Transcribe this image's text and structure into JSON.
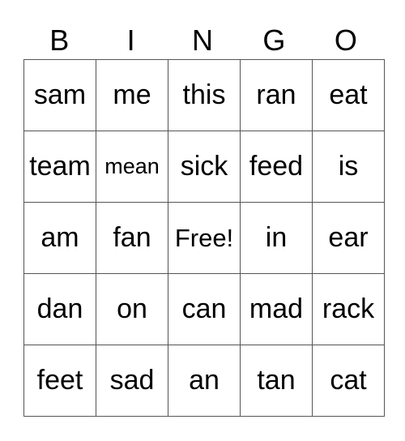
{
  "header": [
    "B",
    "I",
    "N",
    "G",
    "O"
  ],
  "rows": [
    [
      "sam",
      "me",
      "this",
      "ran",
      "eat"
    ],
    [
      "team",
      "mean",
      "sick",
      "feed",
      "is"
    ],
    [
      "am",
      "fan",
      "Free!",
      "in",
      "ear"
    ],
    [
      "dan",
      "on",
      "can",
      "mad",
      "rack"
    ],
    [
      "feet",
      "sad",
      "an",
      "tan",
      "cat"
    ]
  ]
}
